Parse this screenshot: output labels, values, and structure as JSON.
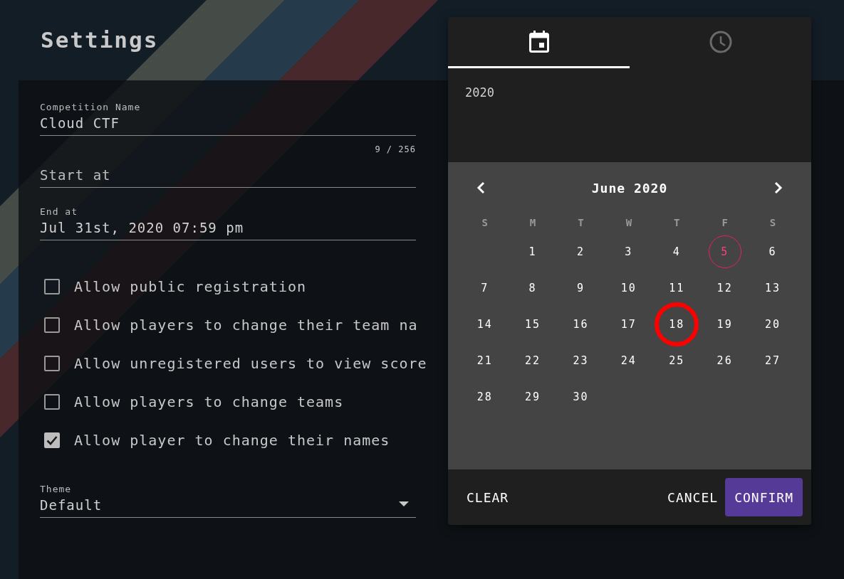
{
  "page": {
    "title": "Settings"
  },
  "form": {
    "fields": [
      {
        "label": "Competition Name",
        "value": "Cloud CTF",
        "counter": "9 / 256"
      },
      {
        "placeholder": "Start at"
      },
      {
        "label": "End at",
        "value": "Jul 31st, 2020 07:59 pm"
      }
    ],
    "checkboxes": [
      {
        "label": "Allow public registration",
        "checked": false
      },
      {
        "label": "Allow players to change their team na",
        "checked": false
      },
      {
        "label": "Allow unregistered users to view score",
        "checked": false
      },
      {
        "label": "Allow players to change teams",
        "checked": false
      },
      {
        "label": "Allow player to change their names",
        "checked": true
      }
    ],
    "theme": {
      "label": "Theme",
      "value": "Default"
    }
  },
  "date_picker": {
    "tabs": [
      {
        "kind": "date",
        "selected": true
      },
      {
        "kind": "time",
        "selected": false
      }
    ],
    "year": "2020",
    "month": "June 2020",
    "weekdays": [
      "S",
      "M",
      "T",
      "W",
      "T",
      "F",
      "S"
    ],
    "weeks": [
      [
        {
          "label": "1",
          "today": false,
          "circled": false
        },
        {
          "label": "2",
          "today": false,
          "circled": false
        },
        {
          "label": "3",
          "today": false,
          "circled": false
        },
        {
          "label": "4",
          "today": false,
          "circled": false
        },
        {
          "label": "5",
          "today": true,
          "circled": false
        },
        {
          "label": "6",
          "today": false,
          "circled": false
        }
      ],
      [
        {
          "label": "7",
          "today": false,
          "circled": false
        },
        {
          "label": "8",
          "today": false,
          "circled": false
        },
        {
          "label": "9",
          "today": false,
          "circled": false
        },
        {
          "label": "10",
          "today": false,
          "circled": false
        },
        {
          "label": "11",
          "today": false,
          "circled": false
        },
        {
          "label": "12",
          "today": false,
          "circled": false
        },
        {
          "label": "13",
          "today": false,
          "circled": false
        }
      ],
      [
        {
          "label": "14",
          "today": false,
          "circled": false
        },
        {
          "label": "15",
          "today": false,
          "circled": false
        },
        {
          "label": "16",
          "today": false,
          "circled": false
        },
        {
          "label": "17",
          "today": false,
          "circled": false
        },
        {
          "label": "18",
          "today": false,
          "circled": true
        },
        {
          "label": "19",
          "today": false,
          "circled": false
        },
        {
          "label": "20",
          "today": false,
          "circled": false
        }
      ],
      [
        {
          "label": "21",
          "today": false,
          "circled": false
        },
        {
          "label": "22",
          "today": false,
          "circled": false
        },
        {
          "label": "23",
          "today": false,
          "circled": false
        },
        {
          "label": "24",
          "today": false,
          "circled": false
        },
        {
          "label": "25",
          "today": false,
          "circled": false
        },
        {
          "label": "26",
          "today": false,
          "circled": false
        },
        {
          "label": "27",
          "today": false,
          "circled": false
        }
      ],
      [
        {
          "label": "28",
          "today": false,
          "circled": false
        },
        {
          "label": "29",
          "today": false,
          "circled": false
        },
        {
          "label": "30",
          "today": false,
          "circled": false
        }
      ]
    ],
    "buttons": [
      {
        "kind": "text",
        "label": "CLEAR"
      },
      {
        "kind": "text",
        "label": "CANCEL"
      },
      {
        "kind": "primary",
        "label": "CONFIRM"
      }
    ]
  }
}
